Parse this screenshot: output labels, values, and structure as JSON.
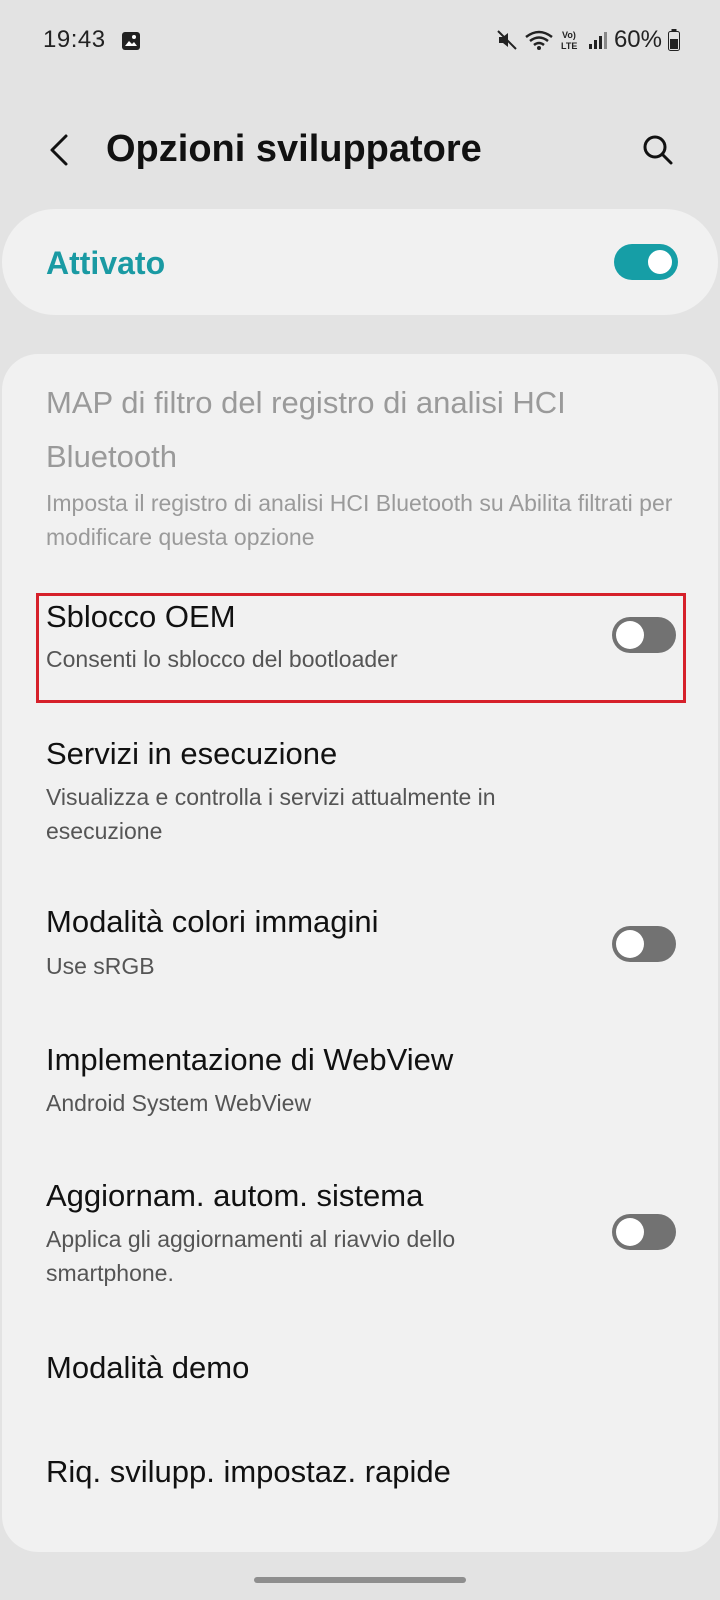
{
  "status_bar": {
    "time": "19:43",
    "battery": "60%",
    "icons": [
      "gallery-icon",
      "mute-icon",
      "wifi-icon",
      "volte-icon",
      "signal-icon",
      "battery-icon"
    ]
  },
  "header": {
    "title": "Opzioni sviluppatore",
    "back_icon": "back-arrow-icon",
    "search_icon": "search-icon"
  },
  "master": {
    "label": "Attivato",
    "enabled": true
  },
  "settings": [
    {
      "title": "MAP di filtro del registro di analisi HCI Bluetooth",
      "subtitle": "Imposta il registro di analisi HCI Bluetooth su Abilita filtrati per modificare questa opzione",
      "disabled": true
    },
    {
      "title": "Sblocco OEM",
      "subtitle": "Consenti lo sblocco del bootloader",
      "toggle": false,
      "highlighted": true
    },
    {
      "title": "Servizi in esecuzione",
      "subtitle": "Visualizza e controlla i servizi attualmente in esecuzione"
    },
    {
      "title": "Modalità colori immagini",
      "subtitle": "Use sRGB",
      "toggle": false
    },
    {
      "title": "Implementazione di WebView",
      "subtitle": "Android System WebView"
    },
    {
      "title": "Aggiornam. autom. sistema",
      "subtitle": "Applica gli aggiornamenti al riavvio dello smartphone.",
      "toggle": false
    },
    {
      "title": "Modalità demo"
    },
    {
      "title": "Riq. svilupp. impostaz. rapide"
    }
  ],
  "colors": {
    "accent": "#169ea6",
    "accent_text": "#1a9aa3",
    "highlight": "#d6202a",
    "background": "#e3e3e3",
    "card": "#f1f1f1"
  }
}
